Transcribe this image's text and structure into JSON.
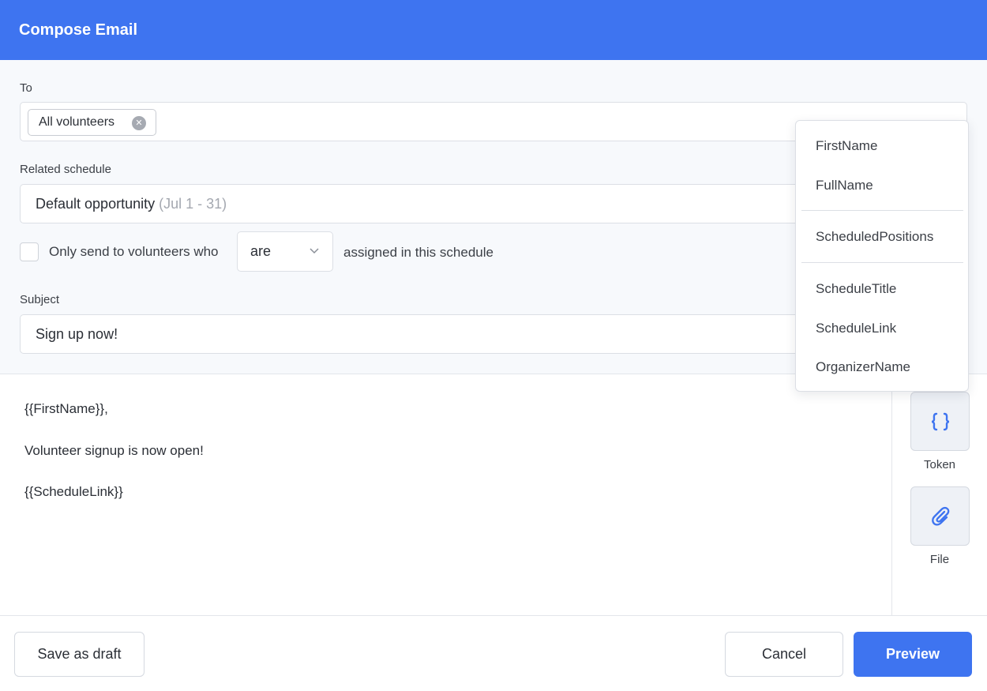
{
  "header": {
    "title": "Compose Email"
  },
  "to": {
    "label": "To",
    "chips": [
      {
        "label": "All volunteers",
        "remove_icon": "close-circle-icon"
      }
    ]
  },
  "schedule": {
    "label": "Related schedule",
    "value": "Default opportunity",
    "date_range": "(Jul 1 - 31)"
  },
  "filter": {
    "checked": false,
    "prefix": "Only send to volunteers who",
    "select_value": "are",
    "suffix": "assigned in this schedule"
  },
  "subject": {
    "label": "Subject",
    "value": "Sign up now!"
  },
  "body": {
    "lines": [
      "{{FirstName}},",
      "Volunteer signup is now open!",
      "{{ScheduleLink}}"
    ]
  },
  "side_tools": {
    "token": {
      "label": "Token",
      "icon": "curly-braces-icon"
    },
    "file": {
      "label": "File",
      "icon": "paperclip-icon"
    }
  },
  "token_menu": {
    "groups": [
      [
        "FirstName",
        "FullName"
      ],
      [
        "ScheduledPositions"
      ],
      [
        "ScheduleTitle",
        "ScheduleLink",
        "OrganizerName"
      ]
    ]
  },
  "footer": {
    "save_draft": "Save as draft",
    "cancel": "Cancel",
    "preview": "Preview"
  },
  "colors": {
    "primary": "#3e74f0",
    "form_bg": "#f7f9fc",
    "border": "#dcdfe5"
  }
}
